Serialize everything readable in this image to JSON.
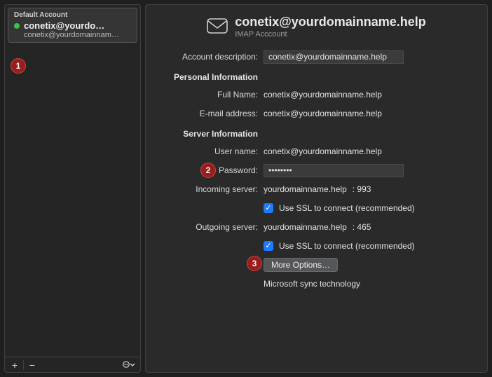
{
  "sidebar": {
    "account": {
      "default_label": "Default Account",
      "primary": "conetix@yourdo…",
      "secondary": "conetix@yourdomainnam…"
    },
    "toolbar": {
      "add": "+",
      "remove": "−",
      "menu": "⋯"
    }
  },
  "header": {
    "title": "conetix@yourdomainname.help",
    "subtitle": "IMAP Acccount"
  },
  "form": {
    "account_description_label": "Account description:",
    "account_description_value": "conetix@yourdomainname.help",
    "personal_info_header": "Personal Information",
    "full_name_label": "Full Name:",
    "full_name_value": "conetix@yourdomainname.help",
    "email_label": "E-mail address:",
    "email_value": "conetix@yourdomainname.help",
    "server_info_header": "Server Information",
    "user_name_label": "User name:",
    "user_name_value": "conetix@yourdomainname.help",
    "password_label": "Password:",
    "password_value": "••••••••",
    "incoming_label": "Incoming server:",
    "incoming_host": "yourdomainname.help",
    "incoming_port": ": 993",
    "outgoing_label": "Outgoing server:",
    "outgoing_host": "yourdomainname.help",
    "outgoing_port": ": 465",
    "use_ssl_label": "Use SSL to connect (recommended)",
    "more_options_label": "More Options…",
    "sync_tech_label": "Microsoft sync technology"
  },
  "callouts": {
    "c1": "1",
    "c2": "2",
    "c3": "3"
  }
}
